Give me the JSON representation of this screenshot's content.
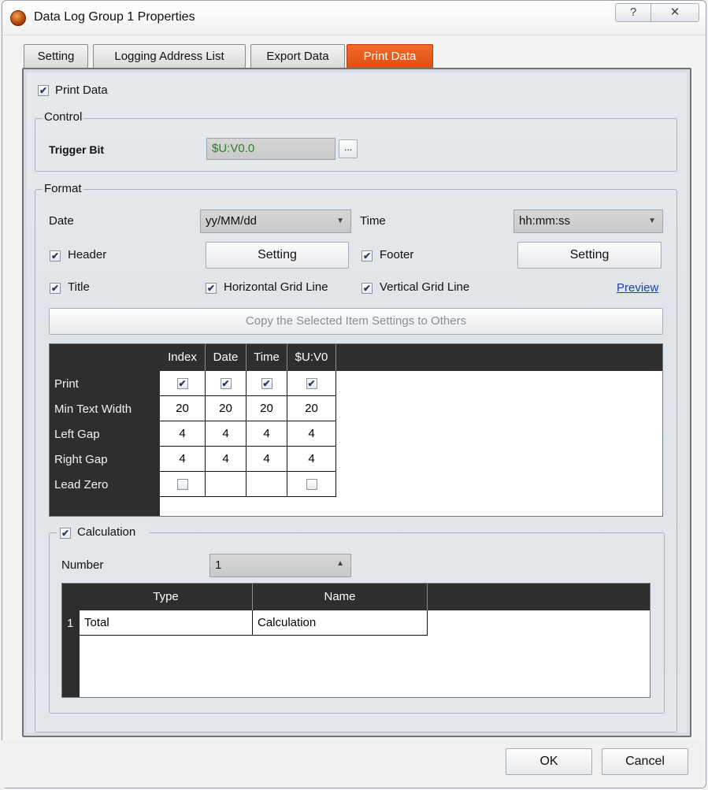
{
  "window": {
    "title": "Data Log Group 1 Properties",
    "help_label": "?",
    "close_label": "✕"
  },
  "tabs": [
    {
      "label": "Setting"
    },
    {
      "label": "Logging Address List"
    },
    {
      "label": "Export Data"
    },
    {
      "label": "Print Data",
      "active": true
    }
  ],
  "print_data": {
    "label": "Print Data",
    "checked": true
  },
  "control": {
    "legend": "Control",
    "trigger_bit_label": "Trigger Bit",
    "trigger_bit_value": "$U:V0.0",
    "browse_label": "..."
  },
  "format": {
    "legend": "Format",
    "date_label": "Date",
    "date_value": "yy/MM/dd",
    "time_label": "Time",
    "time_value": "hh:mm:ss",
    "header_label": "Header",
    "header_setting": "Setting",
    "footer_label": "Footer",
    "footer_setting": "Setting",
    "title_label": "Title",
    "hgrid_label": "Horizontal Grid Line",
    "vgrid_label": "Vertical  Grid Line",
    "preview_label": "Preview",
    "copy_label": "Copy the Selected Item Settings to Others"
  },
  "grid": {
    "columns": [
      "Index",
      "Date",
      "Time",
      "$U:V0"
    ],
    "rows": [
      {
        "label": "Print",
        "values": [
          "✔",
          "✔",
          "✔",
          "✔"
        ]
      },
      {
        "label": "Min Text Width",
        "values": [
          "20",
          "20",
          "20",
          "20"
        ]
      },
      {
        "label": "Left Gap",
        "values": [
          "4",
          "4",
          "4",
          "4"
        ]
      },
      {
        "label": "Right Gap",
        "values": [
          "4",
          "4",
          "4",
          "4"
        ]
      },
      {
        "label": "Lead Zero",
        "values": [
          "",
          "",
          "",
          ""
        ]
      }
    ]
  },
  "calculation": {
    "label": "Calculation",
    "checked": true,
    "number_label": "Number",
    "number_value": "1",
    "columns": [
      "Type",
      "Name"
    ],
    "rows": [
      {
        "index": "1",
        "type": "Total",
        "name": "Calculation"
      }
    ]
  },
  "footer": {
    "ok_label": "OK",
    "cancel_label": "Cancel"
  },
  "colors": {
    "active_tab": "#de4f12",
    "grid_header": "#2e2e2e",
    "trigger_value_text": "#2f7d2f"
  }
}
